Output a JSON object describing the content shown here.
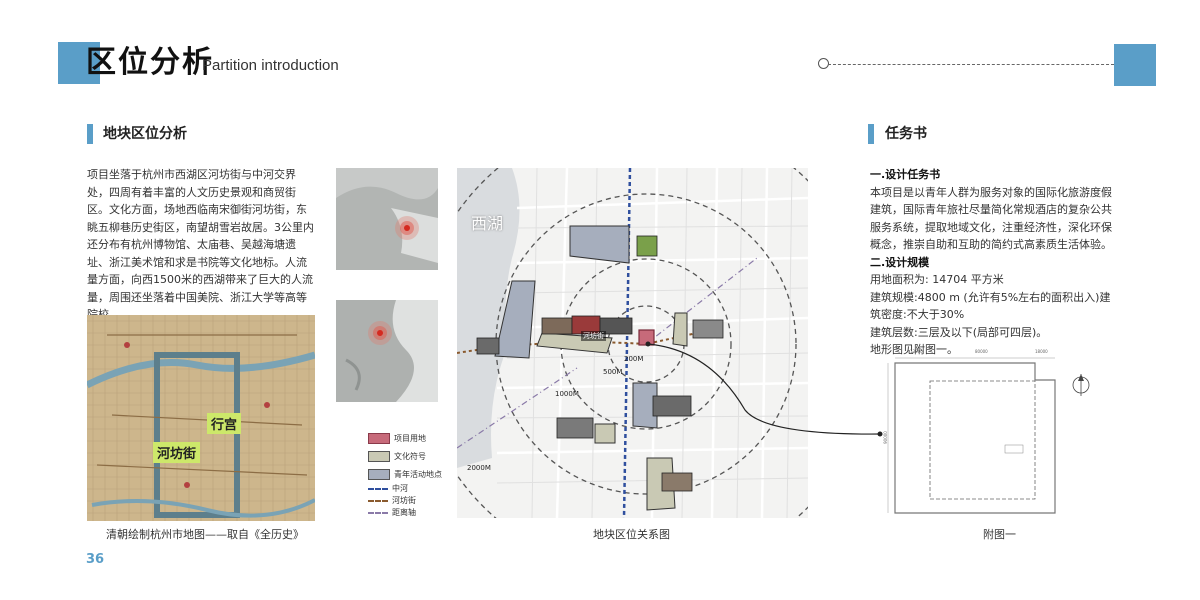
{
  "header": {
    "title": "区位分析",
    "subtitle": "Partition introduction"
  },
  "left_section": {
    "title": "地块区位分析",
    "paragraph": "项目坐落于杭州市西湖区河坊街与中河交界处，四周有着丰富的人文历史景观和商贸街区。文化方面，场地西临南宋御街河坊街，东眺五柳巷历史街区，南望胡雪岩故居。3公里内还分布有杭州博物馆、太庙巷、吴越海塘遗址、浙江美术馆和求是书院等文化地标。人流量方面，向西1500米的西湖带来了巨大的人流量，周围还坐落着中国美院、浙江大学等高等院校。"
  },
  "old_map": {
    "label_palace": "行宫",
    "label_street": "河坊街",
    "caption": "清朝绘制杭州市地图——取自《全历史》"
  },
  "legend": {
    "items": [
      {
        "label": "项目用地",
        "color": "#c76a7a"
      },
      {
        "label": "文化符号",
        "color": "#c9c9b4"
      },
      {
        "label": "青年活动地点",
        "color": "#a6aebd"
      },
      {
        "label": "中河",
        "color": "#2f4f9e"
      },
      {
        "label": "河坊街",
        "color": "#8a5a2e"
      },
      {
        "label": "距离轴",
        "color": "#8a7aa8"
      }
    ]
  },
  "main_map": {
    "lake_label": "西湖",
    "ring_labels": [
      "200M",
      "500M",
      "1000M",
      "2000M"
    ],
    "street_label": "河坊街",
    "caption": "地块区位关系图"
  },
  "right_section": {
    "title": "任务书",
    "h1": "一.设计任务书",
    "p1": "本项目是以青年人群为服务对象的国际化旅游度假建筑，国际青年旅社尽量简化常规酒店的复杂公共服务系统，提取地域文化，注重经济性，深化环保概念，推崇自助和互助的简约式高素质生活体验。",
    "h2": "二.设计规模",
    "lines": [
      "用地面积为: 14704 平方米",
      "建筑规模:4800 m (允许有5%左右的面积出入)建筑密度:不大于30%",
      "建筑层数:三层及以下(局部可四层)。",
      "地形图见附图一。"
    ],
    "plan_caption": "附图一",
    "dims_top": [
      "13000",
      "80000",
      "18000"
    ],
    "dim_left": "90000"
  },
  "page_number": "36"
}
